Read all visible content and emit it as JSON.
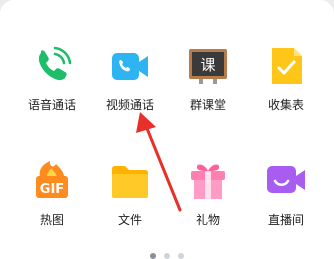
{
  "apps": [
    {
      "label": "语音通话",
      "icon": "voice-call-icon"
    },
    {
      "label": "视频通话",
      "icon": "video-call-icon"
    },
    {
      "label": "群课堂",
      "icon": "group-class-icon",
      "icon_text": "课"
    },
    {
      "label": "收集表",
      "icon": "collection-form-icon"
    },
    {
      "label": "热图",
      "icon": "hot-gif-icon",
      "icon_text": "GIF"
    },
    {
      "label": "文件",
      "icon": "file-folder-icon"
    },
    {
      "label": "礼物",
      "icon": "gift-icon"
    },
    {
      "label": "直播间",
      "icon": "live-room-icon"
    }
  ],
  "pager": {
    "pages": 3,
    "current": 1
  },
  "colors": {
    "green": "#1ebd6a",
    "video_blue": "#2fb4f2",
    "board_dark": "#3a3a3a",
    "form_yellow": "#ffc61a",
    "gif_orange": "#ff8a1d",
    "folder_yellow": "#ffc928",
    "gift_pink": "#ff7fb3",
    "live_purple": "#a85cf0",
    "arrow_red": "#e8302b"
  }
}
